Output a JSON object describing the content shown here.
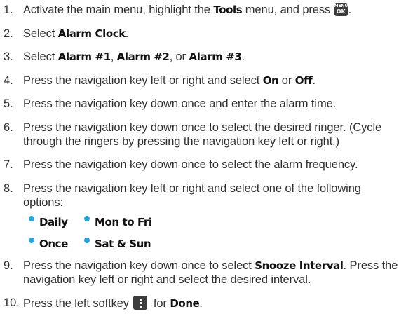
{
  "steps": [
    {
      "num": "1.",
      "pre": "Activate the main menu, highlight the ",
      "b1": "Tools",
      "mid": " menu, and press ",
      "post": "."
    },
    {
      "num": "2.",
      "pre": "Select ",
      "b1": "Alarm Clock",
      "post": "."
    },
    {
      "num": "3.",
      "pre": "Select ",
      "b1": "Alarm #1",
      "s1": ", ",
      "b2": "Alarm #2",
      "s2": ", or ",
      "b3": "Alarm #3",
      "post": "."
    },
    {
      "num": "4.",
      "pre": "Press the navigation key left or right and select ",
      "b1": "On",
      "s1": " or ",
      "b2": "Off",
      "post": "."
    },
    {
      "num": "5.",
      "text": "Press the navigation key down once and enter the alarm time."
    },
    {
      "num": "6.",
      "line1": "Press the navigation key down once to select the desired ringer. (Cycle",
      "line2": "through the ringers by pressing the navigation key left or right.)"
    },
    {
      "num": "7.",
      "text": "Press the navigation key down once to select the alarm frequency."
    },
    {
      "num": "8.",
      "line1": "Press the navigation key left or right and select one of the following",
      "line2": "options:"
    },
    {
      "num": "9.",
      "pre": "Press the navigation key down once to select ",
      "b1": "Snooze Interval",
      "post": ". Press the",
      "line2": "navigation key left or right and select the desired interval."
    },
    {
      "num": "10.",
      "pre": "Press the left softkey ",
      "mid": " for ",
      "b1": "Done",
      "post": "."
    }
  ],
  "options": [
    "Daily",
    "Mon to Fri",
    "Once",
    "Sat & Sun"
  ],
  "icons": {
    "menu_ok_key": {
      "top": "MENU",
      "bottom": "OK"
    },
    "softkey": "left-softkey-icon"
  },
  "colors": {
    "bullet": "#29a8e0",
    "text": "#2f2f2f",
    "key": "#3c3c3c"
  }
}
